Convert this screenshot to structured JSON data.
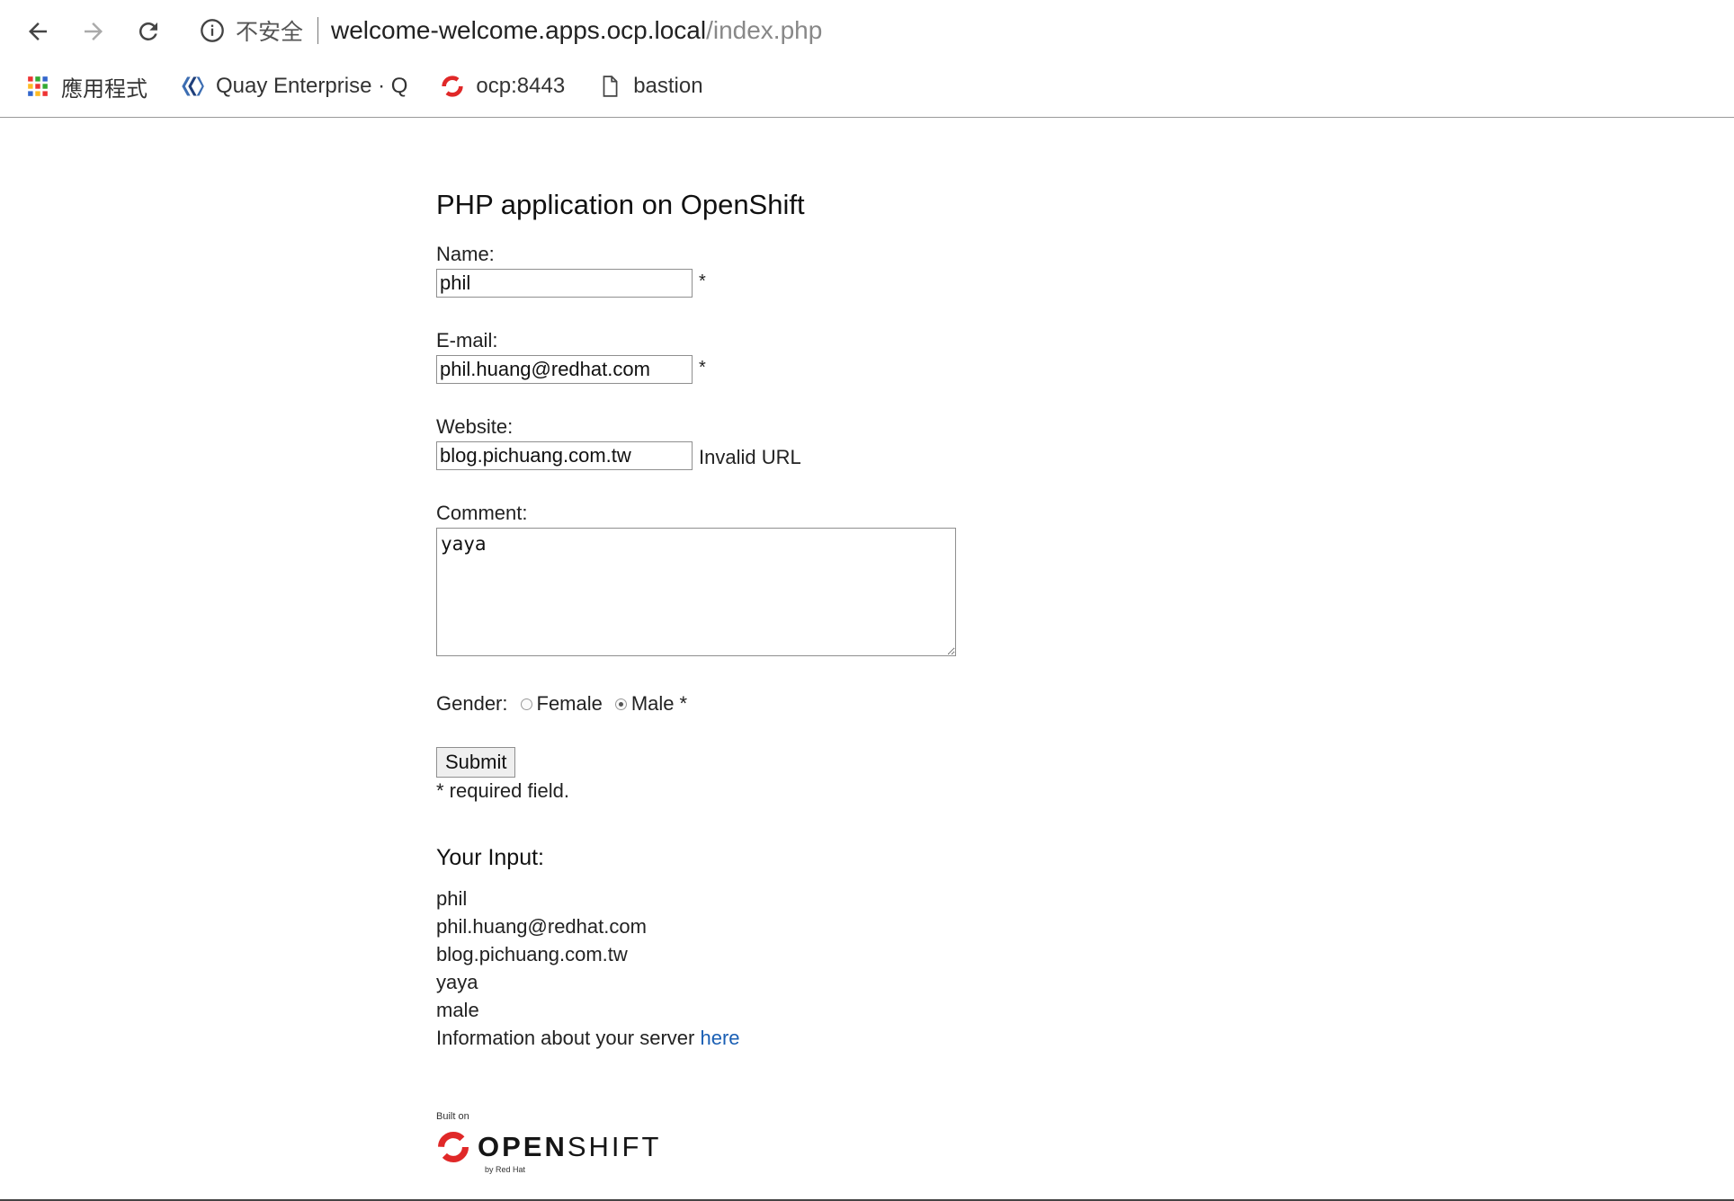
{
  "browser": {
    "security_label": "不安全",
    "url_host": "welcome-welcome.apps.ocp.local",
    "url_path": "/index.php",
    "bookmarks": [
      {
        "label": "應用程式",
        "icon": "apps-grid-icon"
      },
      {
        "label": "Quay Enterprise · Q",
        "icon": "quay-logo-icon"
      },
      {
        "label": "ocp:8443",
        "icon": "openshift-logo-icon"
      },
      {
        "label": "bastion",
        "icon": "page-icon"
      }
    ]
  },
  "form": {
    "title": "PHP application on OpenShift",
    "name_label": "Name:",
    "name_value": "phil",
    "email_label": "E-mail:",
    "email_value": "phil.huang@redhat.com",
    "website_label": "Website:",
    "website_value": "blog.pichuang.com.tw",
    "website_error": "Invalid URL",
    "comment_label": "Comment:",
    "comment_value": "yaya",
    "required_mark": "*",
    "gender_label": "Gender:",
    "gender_options": [
      {
        "label": "Female",
        "selected": false
      },
      {
        "label": "Male",
        "selected": true
      }
    ],
    "submit_label": "Submit",
    "required_note": "* required field."
  },
  "output": {
    "heading": "Your Input:",
    "lines": [
      "phil",
      "phil.huang@redhat.com",
      "blog.pichuang.com.tw",
      "yaya",
      "male"
    ],
    "server_info_text": "Information about your server ",
    "server_info_link": "here"
  },
  "footer": {
    "built_on": "Built on",
    "logo_bold": "OPEN",
    "logo_rest": "SHIFT",
    "by_red_hat": "by Red Hat"
  },
  "colors": {
    "link": "#1a5fb4",
    "openshift_red": "#e02828",
    "quay_blue": "#3c6db2"
  }
}
